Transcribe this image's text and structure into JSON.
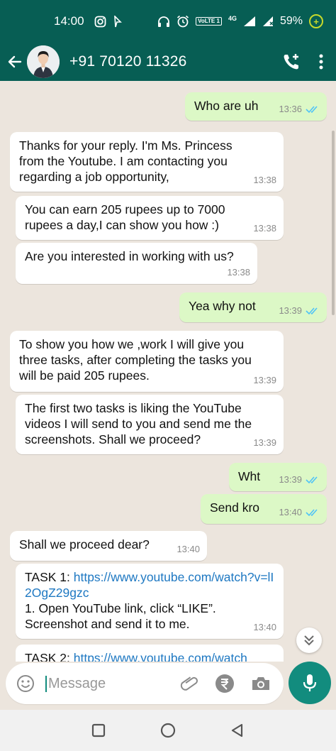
{
  "status_bar": {
    "time": "14:00",
    "network": "4G",
    "volte": "VoLTE 1",
    "battery": "59%",
    "battery_charge_glyph": "+"
  },
  "header": {
    "contact": "+91 70120 11326",
    "add_call_icon": "add-call-icon",
    "more_icon": "more-vert-icon"
  },
  "messages": [
    {
      "dir": "out",
      "text": "Who are uh",
      "time": "13:36",
      "ticks": "read"
    },
    {
      "dir": "in",
      "text": "Thanks for your reply. I'm Ms. Princess from the Youtube. I am contacting you regarding a job opportunity,",
      "time": "13:38"
    },
    {
      "dir": "in",
      "text": "You can earn 205 rupees up to 7000 rupees a day,I can show you how :)",
      "time": "13:38"
    },
    {
      "dir": "in",
      "text": "Are you interested in working with us?",
      "time": "13:38"
    },
    {
      "dir": "out",
      "text": "Yea why not",
      "time": "13:39",
      "ticks": "read"
    },
    {
      "dir": "in",
      "text": "To show you how we ,work I will give you three tasks, after completing the tasks you will be paid 205 rupees.",
      "time": "13:39"
    },
    {
      "dir": "in",
      "text": "The first two tasks is liking the YouTube videos I will send to you and send me the screenshots. Shall we proceed?",
      "time": "13:39"
    },
    {
      "dir": "out",
      "text": "Wht",
      "time": "13:39",
      "ticks": "read"
    },
    {
      "dir": "out",
      "text": "Send kro",
      "time": "13:40",
      "ticks": "read"
    },
    {
      "dir": "in",
      "text": "Shall we proceed dear?",
      "time": "13:40"
    },
    {
      "dir": "in",
      "prefix": "TASK 1: ",
      "link": "https://www.youtube.com/watch?v=lI2OgZ29gzc",
      "text": "1. Open YouTube link, click “LIKE”. Screenshot and send it to me.",
      "time": "13:40"
    },
    {
      "dir": "in",
      "prefix": "TASK 2: ",
      "link": "https://www.youtube.com/watch",
      "time": ""
    }
  ],
  "input": {
    "placeholder": "Message",
    "emoji_icon": "emoji-icon",
    "attach_icon": "attach-icon",
    "payment_icon": "rupee-icon",
    "camera_icon": "camera-icon",
    "mic_icon": "mic-icon"
  },
  "colors": {
    "header": "#075e54",
    "outgoing_bubble": "#dcf8c6",
    "incoming_bubble": "#ffffff",
    "accent": "#128c7e",
    "read_ticks": "#4fc3f7",
    "link": "#1e78c2"
  }
}
